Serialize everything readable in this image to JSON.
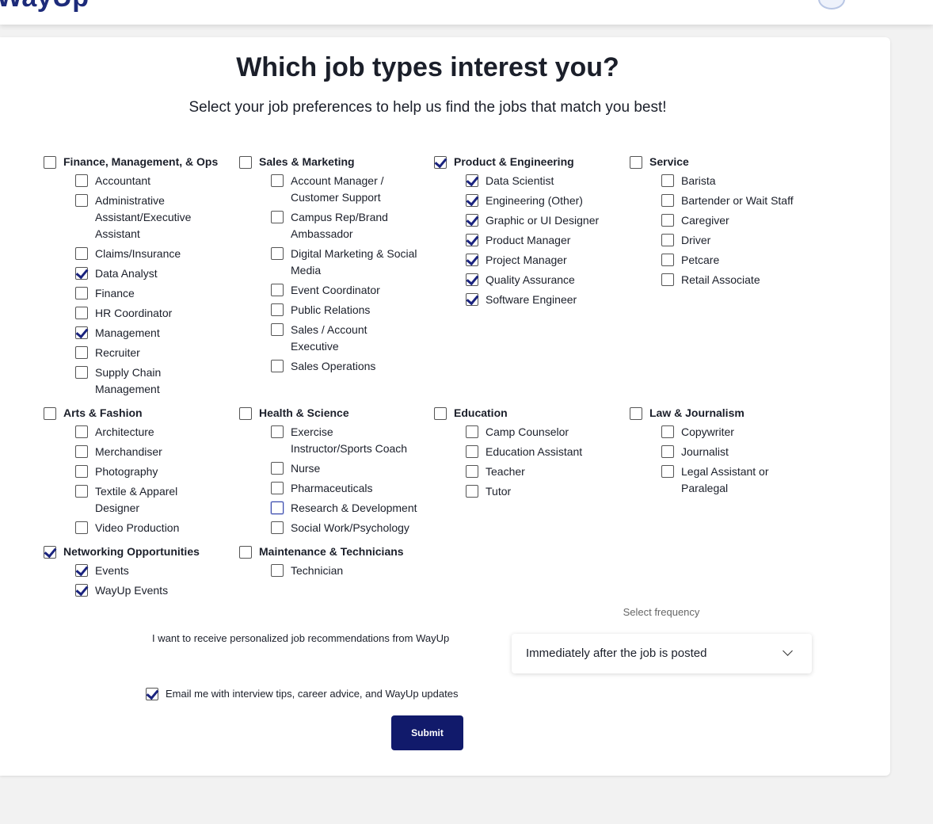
{
  "header": {
    "logo": "WayUp"
  },
  "page": {
    "title": "Which job types interest you?",
    "subtitle": "Select your job preferences to help us find the jobs that match you best!"
  },
  "groups": [
    {
      "id": "finance",
      "label": "Finance, Management, & Ops",
      "checked": false,
      "items": [
        {
          "label": "Accountant",
          "checked": false
        },
        {
          "label": "Administrative Assistant/Executive Assistant",
          "checked": false
        },
        {
          "label": "Claims/Insurance",
          "checked": false
        },
        {
          "label": "Data Analyst",
          "checked": true
        },
        {
          "label": "Finance",
          "checked": false
        },
        {
          "label": "HR Coordinator",
          "checked": false
        },
        {
          "label": "Management",
          "checked": true
        },
        {
          "label": "Recruiter",
          "checked": false
        },
        {
          "label": "Supply Chain Management",
          "checked": false
        }
      ]
    },
    {
      "id": "sales",
      "label": "Sales & Marketing",
      "checked": false,
      "items": [
        {
          "label": "Account Manager / Customer Support",
          "checked": false
        },
        {
          "label": "Campus Rep/Brand Ambassador",
          "checked": false
        },
        {
          "label": "Digital Marketing & Social Media",
          "checked": false
        },
        {
          "label": "Event Coordinator",
          "checked": false
        },
        {
          "label": "Public Relations",
          "checked": false
        },
        {
          "label": "Sales / Account Executive",
          "checked": false
        },
        {
          "label": "Sales Operations",
          "checked": false
        }
      ]
    },
    {
      "id": "product",
      "label": "Product & Engineering",
      "checked": true,
      "items": [
        {
          "label": "Data Scientist",
          "checked": true
        },
        {
          "label": "Engineering (Other)",
          "checked": true
        },
        {
          "label": "Graphic or UI Designer",
          "checked": true
        },
        {
          "label": "Product Manager",
          "checked": true
        },
        {
          "label": "Project Manager",
          "checked": true
        },
        {
          "label": "Quality Assurance",
          "checked": true
        },
        {
          "label": "Software Engineer",
          "checked": true
        }
      ]
    },
    {
      "id": "service",
      "label": "Service",
      "checked": false,
      "items": [
        {
          "label": "Barista",
          "checked": false
        },
        {
          "label": "Bartender or Wait Staff",
          "checked": false
        },
        {
          "label": "Caregiver",
          "checked": false
        },
        {
          "label": "Driver",
          "checked": false
        },
        {
          "label": "Petcare",
          "checked": false
        },
        {
          "label": "Retail Associate",
          "checked": false
        }
      ]
    },
    {
      "id": "arts",
      "label": "Arts & Fashion",
      "checked": false,
      "items": [
        {
          "label": "Architecture",
          "checked": false
        },
        {
          "label": "Merchandiser",
          "checked": false
        },
        {
          "label": "Photography",
          "checked": false
        },
        {
          "label": "Textile & Apparel Designer",
          "checked": false
        },
        {
          "label": "Video Production",
          "checked": false
        }
      ]
    },
    {
      "id": "health",
      "label": "Health & Science",
      "checked": false,
      "items": [
        {
          "label": "Exercise Instructor/Sports Coach",
          "checked": false
        },
        {
          "label": "Nurse",
          "checked": false
        },
        {
          "label": "Pharmaceuticals",
          "checked": false
        },
        {
          "label": "Research & Development",
          "checked": false,
          "focused": true
        },
        {
          "label": "Social Work/Psychology",
          "checked": false
        }
      ]
    },
    {
      "id": "education",
      "label": "Education",
      "checked": false,
      "items": [
        {
          "label": "Camp Counselor",
          "checked": false
        },
        {
          "label": "Education Assistant",
          "checked": false
        },
        {
          "label": "Teacher",
          "checked": false
        },
        {
          "label": "Tutor",
          "checked": false
        }
      ]
    },
    {
      "id": "law",
      "label": "Law & Journalism",
      "checked": false,
      "items": [
        {
          "label": "Copywriter",
          "checked": false
        },
        {
          "label": "Journalist",
          "checked": false
        },
        {
          "label": "Legal Assistant or Paralegal",
          "checked": false
        }
      ]
    },
    {
      "id": "networking",
      "label": "Networking Opportunities",
      "checked": true,
      "items": [
        {
          "label": "Events",
          "checked": true
        },
        {
          "label": "WayUp Events",
          "checked": true
        }
      ]
    },
    {
      "id": "maintenance",
      "label": "Maintenance & Technicians",
      "checked": false,
      "items": [
        {
          "label": "Technician",
          "checked": false
        }
      ]
    }
  ],
  "recommendations": {
    "label": "I want to receive personalized job recommendations from WayUp",
    "frequency_label": "Select frequency",
    "frequency_value": "Immediately after the job is posted"
  },
  "email_optin": {
    "label": "Email me with interview tips, career advice, and WayUp updates",
    "checked": true
  },
  "submit_label": "Submit",
  "colors": {
    "brand": "#111a6b",
    "check": "#1a237e"
  }
}
